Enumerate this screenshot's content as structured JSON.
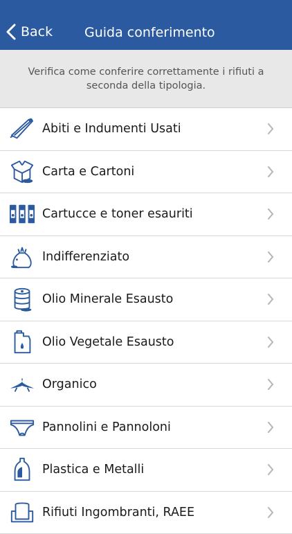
{
  "header": {
    "back_label": "Back",
    "title": "Guida conferimento"
  },
  "intro": {
    "text": "Verifica come conferire correttamente i rifiuti a seconda della tipologia."
  },
  "colors": {
    "brand": "#2c5aa0",
    "icon": "#2c5aa0"
  },
  "items": [
    {
      "label": "Abiti e Indumenti Usati",
      "icon": "hanger-icon"
    },
    {
      "label": "Carta e Cartoni",
      "icon": "box-icon"
    },
    {
      "label": "Cartucce e toner esauriti",
      "icon": "cartridge-icon"
    },
    {
      "label": "Indifferenziato",
      "icon": "trash-bag-icon"
    },
    {
      "label": "Olio Minerale Esausto",
      "icon": "oil-drum-icon"
    },
    {
      "label": "Olio Vegetale Esausto",
      "icon": "oil-can-icon"
    },
    {
      "label": "Organico",
      "icon": "banana-peel-icon"
    },
    {
      "label": "Pannolini e Pannoloni",
      "icon": "diaper-icon"
    },
    {
      "label": "Plastica e Metalli",
      "icon": "bottle-icon"
    },
    {
      "label": "Rifiuti Ingombranti, RAEE",
      "icon": "armchair-icon"
    }
  ]
}
